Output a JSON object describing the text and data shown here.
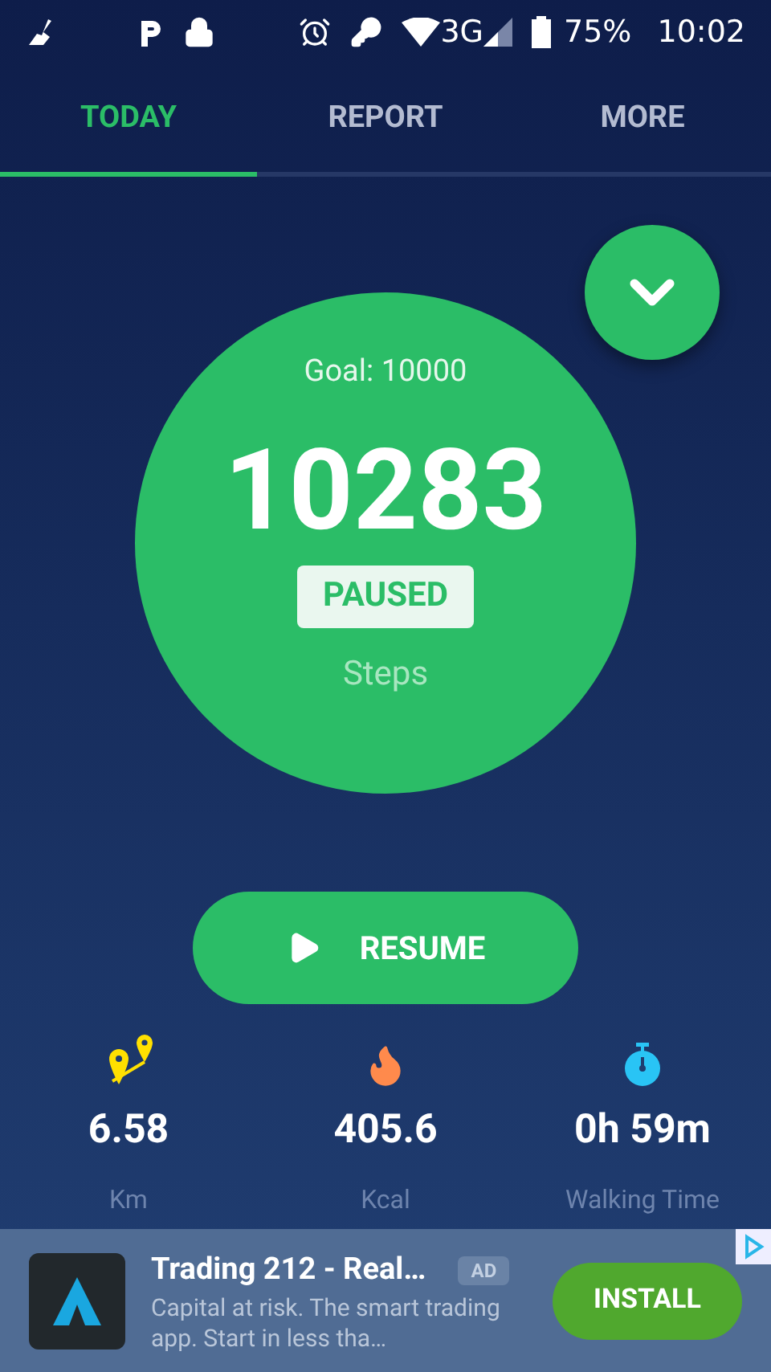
{
  "status_bar": {
    "network": "3G",
    "battery": "75%",
    "time": "10:02"
  },
  "tabs": [
    {
      "label": "TODAY",
      "selected": true
    },
    {
      "label": "REPORT",
      "selected": false
    },
    {
      "label": "MORE",
      "selected": false
    }
  ],
  "goal": "Goal: 10000",
  "steps": "10283",
  "state": "PAUSED",
  "steps_label": "Steps",
  "resume_button": "RESUME",
  "stats": [
    {
      "kind": "distance",
      "value": "6.58",
      "unit": "Km"
    },
    {
      "kind": "calories",
      "value": "405.6",
      "unit": "Kcal"
    },
    {
      "kind": "time",
      "value": "0h 59m",
      "unit": "Walking Time"
    }
  ],
  "ad": {
    "title": "Trading 212 - Real…",
    "badge": "AD",
    "description": "Capital at risk. The smart trading app. Start in less tha…",
    "button": "INSTALL"
  }
}
